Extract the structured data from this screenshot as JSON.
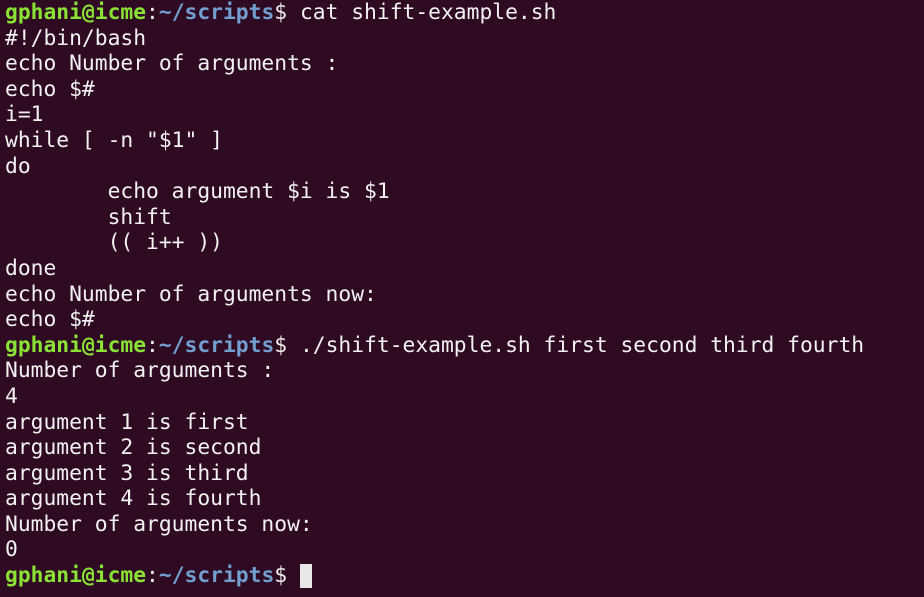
{
  "prompt": {
    "user_host": "gphani@icme",
    "colon": ":",
    "path": "~/scripts",
    "symbol": "$ "
  },
  "colors": {
    "background": "#2f0a23",
    "user_host": "#8ae234",
    "path": "#729fcf",
    "text": "#f2f2f2"
  },
  "lines": [
    {
      "type": "prompt",
      "command": "cat shift-example.sh"
    },
    {
      "type": "output",
      "text": "#!/bin/bash"
    },
    {
      "type": "output",
      "text": "echo Number of arguments :"
    },
    {
      "type": "output",
      "text": "echo $#"
    },
    {
      "type": "output",
      "text": "i=1"
    },
    {
      "type": "output",
      "text": "while [ -n \"$1\" ]"
    },
    {
      "type": "output",
      "text": "do"
    },
    {
      "type": "output",
      "text": "        echo argument $i is $1"
    },
    {
      "type": "output",
      "text": "        shift"
    },
    {
      "type": "output",
      "text": "        (( i++ ))"
    },
    {
      "type": "output",
      "text": "done"
    },
    {
      "type": "output",
      "text": "echo Number of arguments now:"
    },
    {
      "type": "output",
      "text": "echo $#"
    },
    {
      "type": "prompt",
      "command": "./shift-example.sh first second third fourth"
    },
    {
      "type": "output",
      "text": "Number of arguments :"
    },
    {
      "type": "output",
      "text": "4"
    },
    {
      "type": "output",
      "text": "argument 1 is first"
    },
    {
      "type": "output",
      "text": "argument 2 is second"
    },
    {
      "type": "output",
      "text": "argument 3 is third"
    },
    {
      "type": "output",
      "text": "argument 4 is fourth"
    },
    {
      "type": "output",
      "text": "Number of arguments now:"
    },
    {
      "type": "output",
      "text": "0"
    },
    {
      "type": "prompt",
      "command": "",
      "cursor": true
    }
  ]
}
